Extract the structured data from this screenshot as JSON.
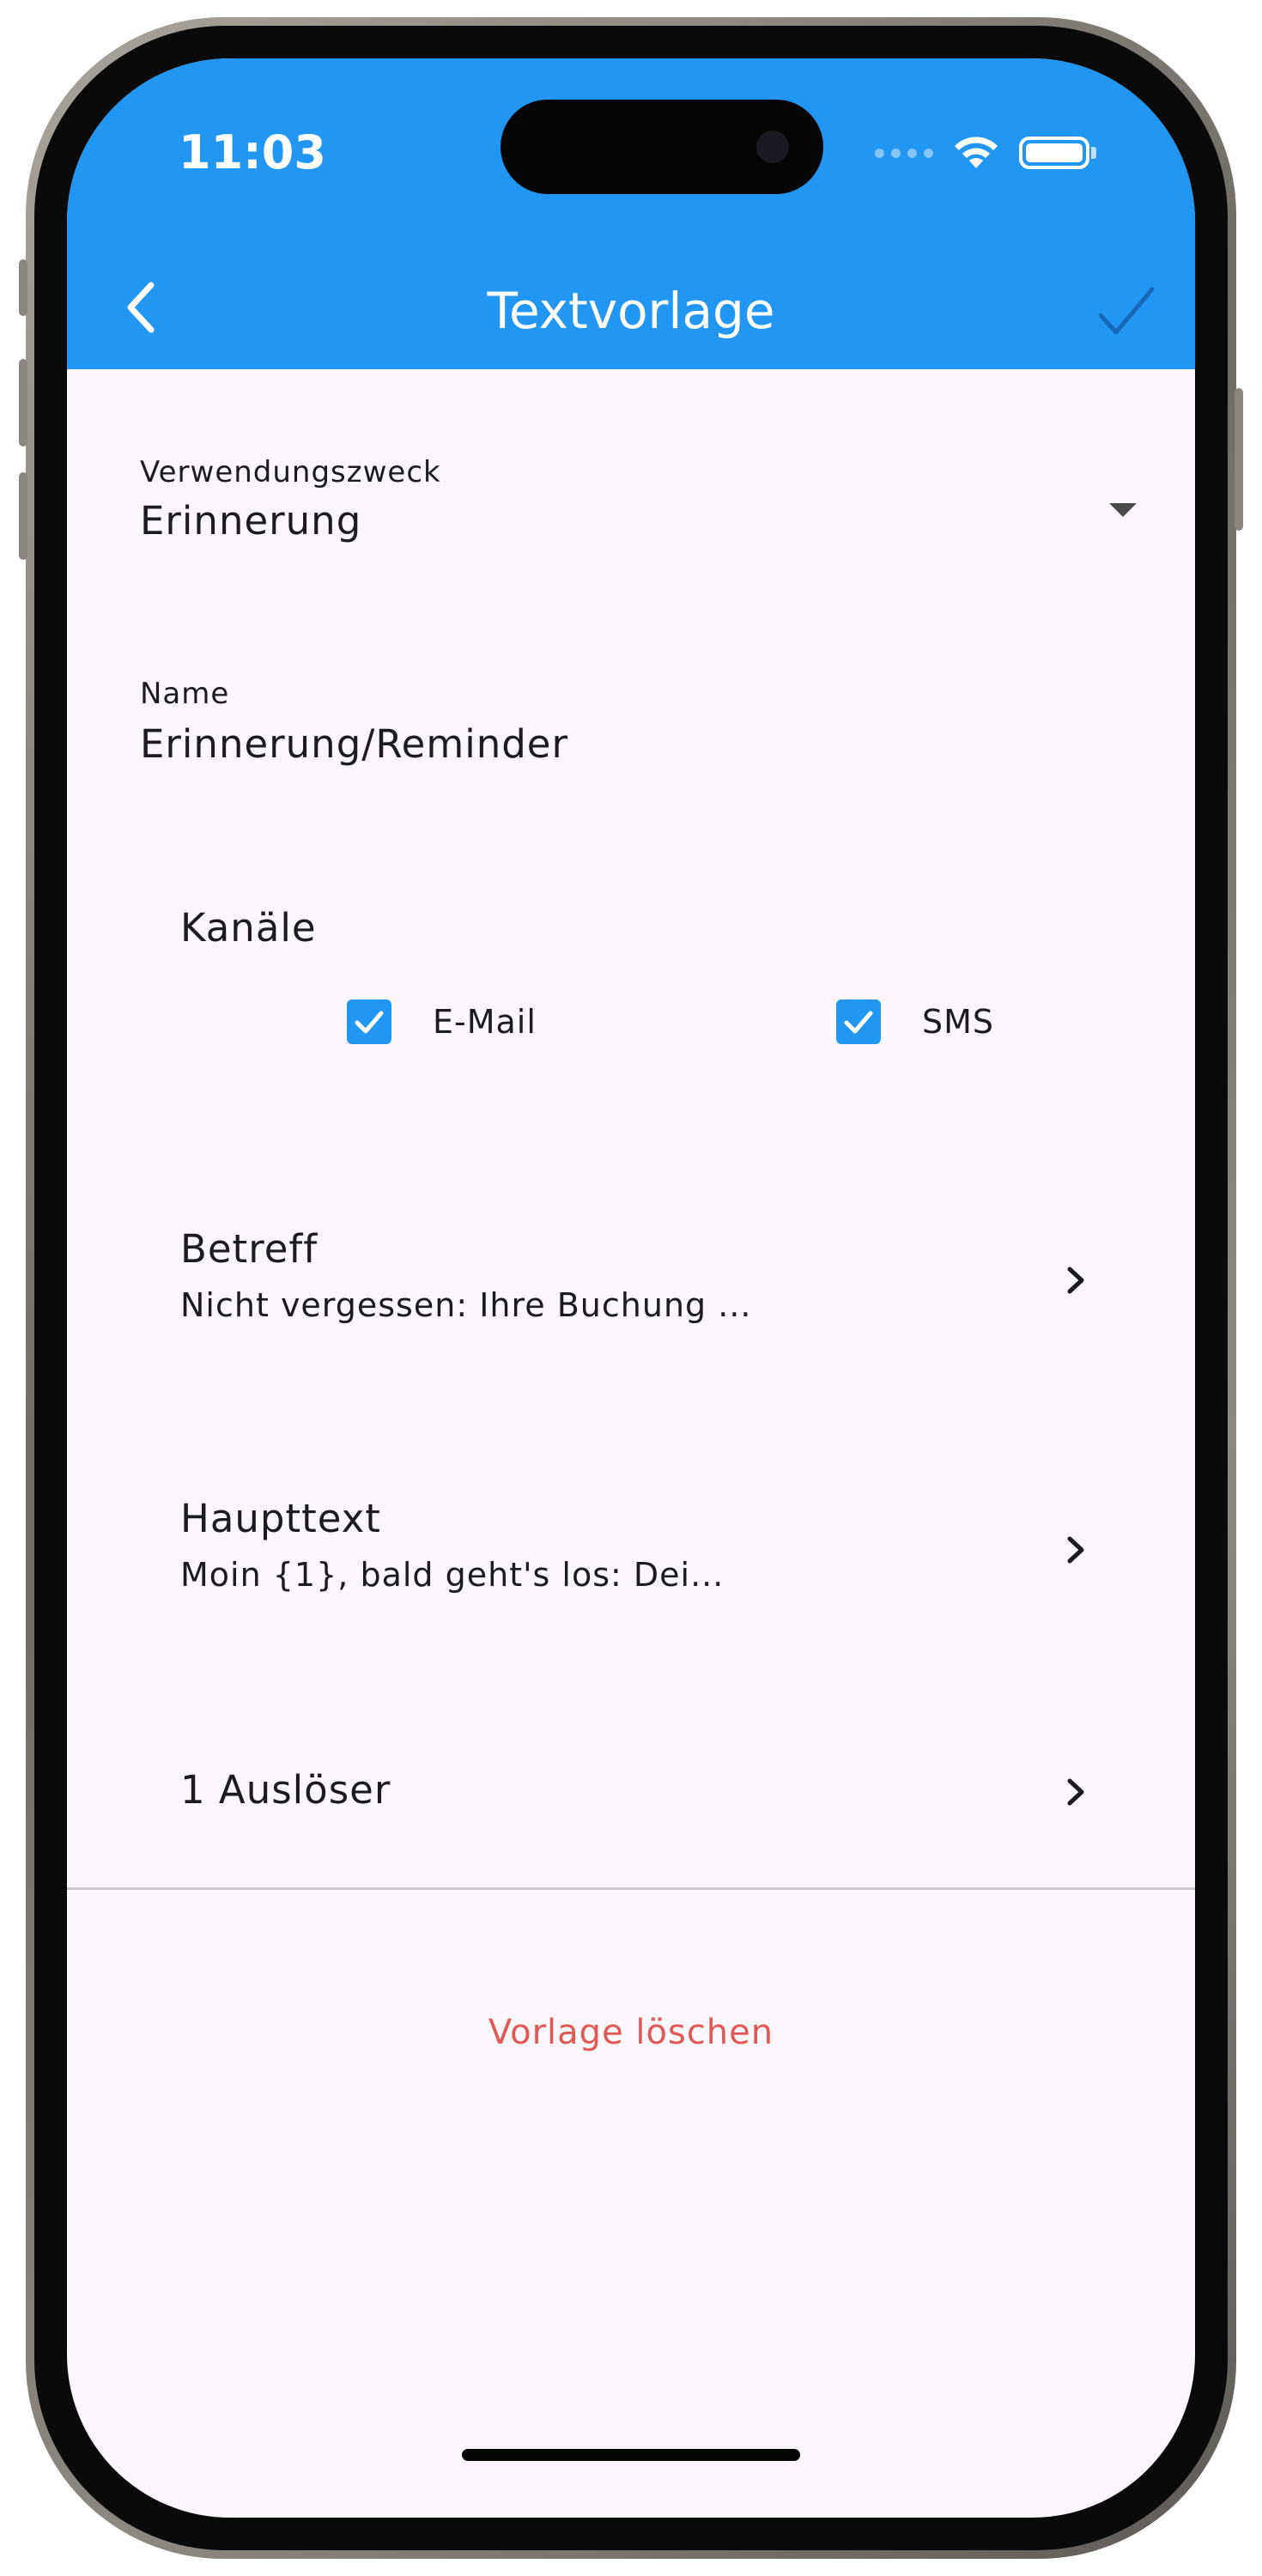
{
  "status_bar": {
    "time": "11:03"
  },
  "app_bar": {
    "title": "Textvorlage",
    "back_icon": "chevron-left-icon",
    "confirm_icon": "check-icon",
    "background_color": "#2196f3"
  },
  "form": {
    "purpose": {
      "label": "Verwendungszweck",
      "value": "Erinnerung"
    },
    "name": {
      "label": "Name",
      "value": "Erinnerung/Reminder"
    }
  },
  "channels": {
    "title": "Kanäle",
    "options": [
      {
        "label": "E-Mail",
        "checked": true
      },
      {
        "label": "SMS",
        "checked": true
      }
    ]
  },
  "items": [
    {
      "title": "Betreff",
      "subtitle": "Nicht vergessen: Ihre Buchung ..."
    },
    {
      "title": "Haupttext",
      "subtitle": "Moin {1}, bald geht's los: Dei..."
    },
    {
      "title": "1 Auslöser",
      "subtitle": ""
    }
  ],
  "delete_button": {
    "label": "Vorlage löschen",
    "color": "#e05a55"
  }
}
